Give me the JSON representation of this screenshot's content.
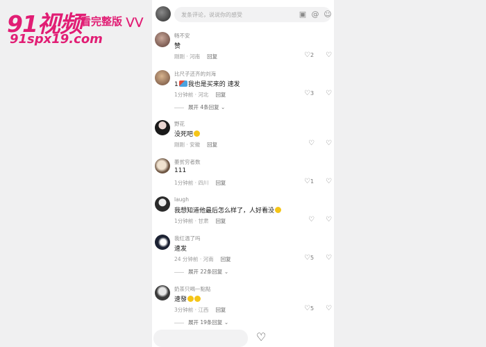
{
  "watermark": {
    "brand": "91视频",
    "tagline": "看完整版",
    "arrows": "⋁⋁",
    "url": "91spx19.com"
  },
  "comment_input": {
    "placeholder": "发条评论，说说你的感受"
  },
  "comments": [
    {
      "username": "畅不安",
      "text": "赞",
      "time": "刚刚",
      "location": "河南",
      "reply": "回复",
      "likes": "2"
    },
    {
      "username": "比尺子还齐的刘海",
      "text_prefix": "1",
      "text": "我也是买来的 速发",
      "time": "1分钟前",
      "location": "河北",
      "reply": "回复",
      "likes": "3",
      "expand": "展开 4条回复"
    },
    {
      "username": "野花",
      "text": "没死吧",
      "time": "刚刚",
      "location": "安徽",
      "reply": "回复",
      "likes": ""
    },
    {
      "username": "萎贫穷者数",
      "text": "111",
      "time": "1分钟前",
      "location": "四川",
      "reply": "回复",
      "likes": "1"
    },
    {
      "username": "laugh",
      "text": "我想知道他最后怎么样了，人好看没",
      "time": "1分钟前",
      "location": "甘肃",
      "reply": "回复",
      "likes": ""
    },
    {
      "username": "我红温了吗",
      "text": "速发",
      "time": "24 分钟前",
      "location": "河南",
      "reply": "回复",
      "likes": "5",
      "expand": "展开 22条回复"
    },
    {
      "username": "奶茶只喝一點點",
      "text": "速發",
      "time": "3分钟前",
      "location": "江西",
      "reply": "回复",
      "likes": "5",
      "expand": "展开 19条回复"
    }
  ],
  "colors": {
    "brand": "#e11d74",
    "background": "#f0f0f1",
    "panel": "#ffffff"
  }
}
